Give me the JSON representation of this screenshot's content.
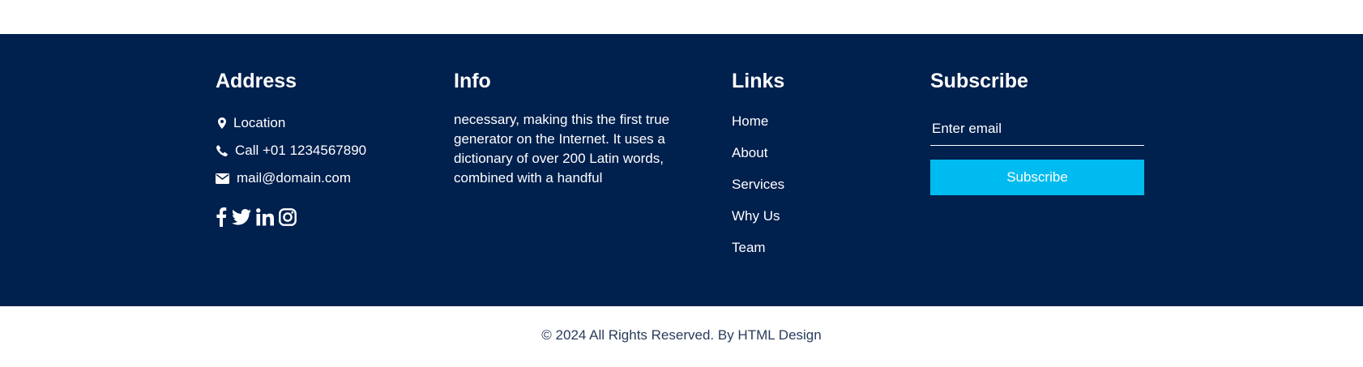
{
  "address": {
    "heading": "Address",
    "location": "Location",
    "phone": "Call +01 1234567890",
    "email": "mail@domain.com",
    "social_icons": [
      "facebook-icon",
      "twitter-icon",
      "linkedin-icon",
      "instagram-icon"
    ]
  },
  "info": {
    "heading": "Info",
    "text": "necessary, making this the first true generator on the Internet. It uses a dictionary of over 200 Latin words, combined with a handful"
  },
  "links": {
    "heading": "Links",
    "items": [
      {
        "label": "Home"
      },
      {
        "label": "About"
      },
      {
        "label": "Services"
      },
      {
        "label": "Why Us"
      },
      {
        "label": "Team"
      }
    ]
  },
  "subscribe": {
    "heading": "Subscribe",
    "placeholder": "Enter email",
    "button_label": "Subscribe"
  },
  "copyright": "© 2024 All Rights Reserved. By HTML Design",
  "colors": {
    "footer_bg": "#00204e",
    "accent": "#00bbf0",
    "text": "#ffffff",
    "copyright_text": "#283c5c"
  }
}
